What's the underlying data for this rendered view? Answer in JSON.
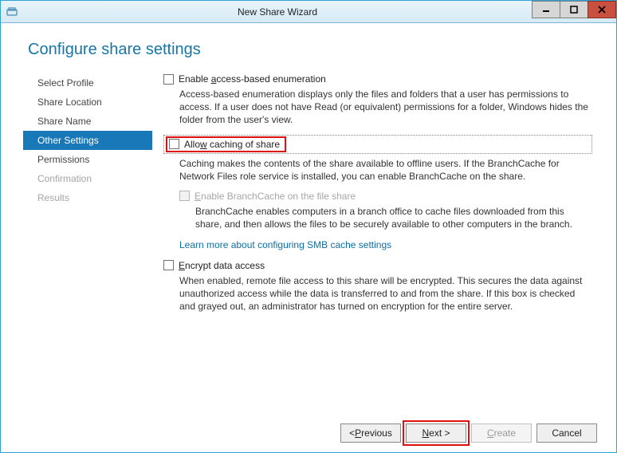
{
  "window": {
    "title": "New Share Wizard"
  },
  "heading": "Configure share settings",
  "nav": {
    "items": [
      {
        "label": "Select Profile"
      },
      {
        "label": "Share Location"
      },
      {
        "label": "Share Name"
      },
      {
        "label": "Other Settings"
      },
      {
        "label": "Permissions"
      },
      {
        "label": "Confirmation"
      },
      {
        "label": "Results"
      }
    ]
  },
  "options": {
    "abe": {
      "label_pre": "Enable ",
      "label_u": "a",
      "label_post": "ccess-based enumeration",
      "desc": "Access-based enumeration displays only the files and folders that a user has permissions to access. If a user does not have Read (or equivalent) permissions for a folder, Windows hides the folder from the user's view."
    },
    "cache": {
      "label_pre": "Allo",
      "label_u": "w",
      "label_post": " caching of share",
      "desc": "Caching makes the contents of the share available to offline users. If the BranchCache for Network Files role service is installed, you can enable BranchCache on the share."
    },
    "branch": {
      "label_u": "E",
      "label_post": "nable BranchCache on the file share",
      "desc": "BranchCache enables computers in a branch office to cache files downloaded from this share, and then allows the files to be securely available to other computers in the branch."
    },
    "link": "Learn more about configuring SMB cache settings",
    "encrypt": {
      "label_u": "E",
      "label_post": "ncrypt data access",
      "desc": "When enabled, remote file access to this share will be encrypted. This secures the data against unauthorized access while the data is transferred to and from the share. If this box is checked and grayed out, an administrator has turned on encryption for the entire server."
    }
  },
  "footer": {
    "prev_pre": "< ",
    "prev_u": "P",
    "prev_post": "revious",
    "next_u": "N",
    "next_post": "ext >",
    "create_u": "C",
    "create_post": "reate",
    "cancel": "Cancel"
  }
}
